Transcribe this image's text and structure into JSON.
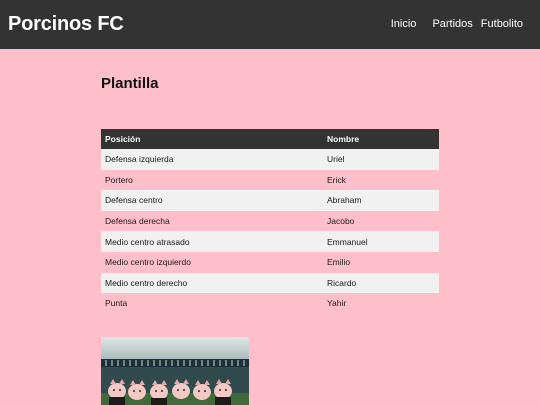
{
  "header": {
    "brand": "Porcinos FC",
    "nav": [
      "Inicio",
      "Partidos",
      "Futbolito"
    ]
  },
  "main": {
    "title": "Plantilla",
    "table": {
      "columns": [
        "Posición",
        "Nombre"
      ],
      "rows": [
        [
          "Defensa izquierda",
          "Uriel"
        ],
        [
          "Portero",
          "Erick"
        ],
        [
          "Defensa centro",
          "Abraham"
        ],
        [
          "Defensa derecha",
          "Jacobo"
        ],
        [
          "Medio centro atrasado",
          "Emmanuel"
        ],
        [
          "Medio centro izquierdo",
          "Emilio"
        ],
        [
          "Medio centro derecho",
          "Ricardo"
        ],
        [
          "Punta",
          "Yahir"
        ]
      ]
    }
  },
  "colors": {
    "background": "#ffbfca",
    "header": "#333333",
    "row_alt": "#f1f1f1"
  }
}
